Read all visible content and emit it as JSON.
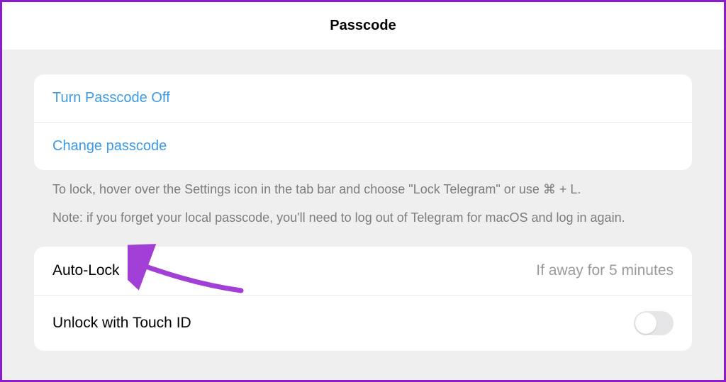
{
  "header": {
    "title": "Passcode"
  },
  "group1": {
    "turn_off_label": "Turn Passcode Off",
    "change_label": "Change passcode"
  },
  "help": {
    "line1": "To lock, hover over the Settings icon in the tab bar and choose \"Lock Telegram\" or use ⌘ + L.",
    "line2": "Note: if you forget your local passcode, you'll need to log out of Telegram for macOS and log in again."
  },
  "group2": {
    "autolock_label": "Auto-Lock",
    "autolock_value": "If away for 5 minutes",
    "touchid_label": "Unlock with Touch ID",
    "touchid_on": false
  },
  "annotation": {
    "arrow_color": "#a23fd6"
  }
}
